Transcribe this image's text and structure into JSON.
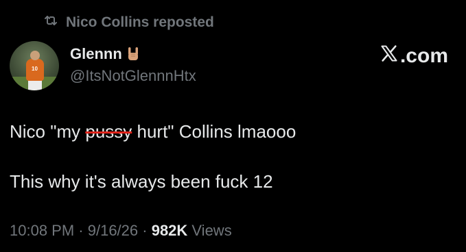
{
  "repost": {
    "text": "Nico Collins reposted",
    "icon": "repost-icon"
  },
  "author": {
    "display_name": "Glennn",
    "emoji": "sign-of-the-horns",
    "handle": "@ItsNotGlennnHtx",
    "avatar_number": "10"
  },
  "branding": {
    "label": ".com",
    "icon": "x-logo-icon"
  },
  "tweet": {
    "line1_prefix": "Nico \"my ",
    "line1_struck": "pussy",
    "line1_suffix": " hurt\" Collins lmaooo",
    "line2": "This why it's always been fuck 12",
    "strike_color": "#e0241b"
  },
  "meta": {
    "time": "10:08 PM",
    "sep1": " · ",
    "date": "9/16/26",
    "sep2": " · ",
    "views_count": "982K",
    "views_label": " Views"
  }
}
